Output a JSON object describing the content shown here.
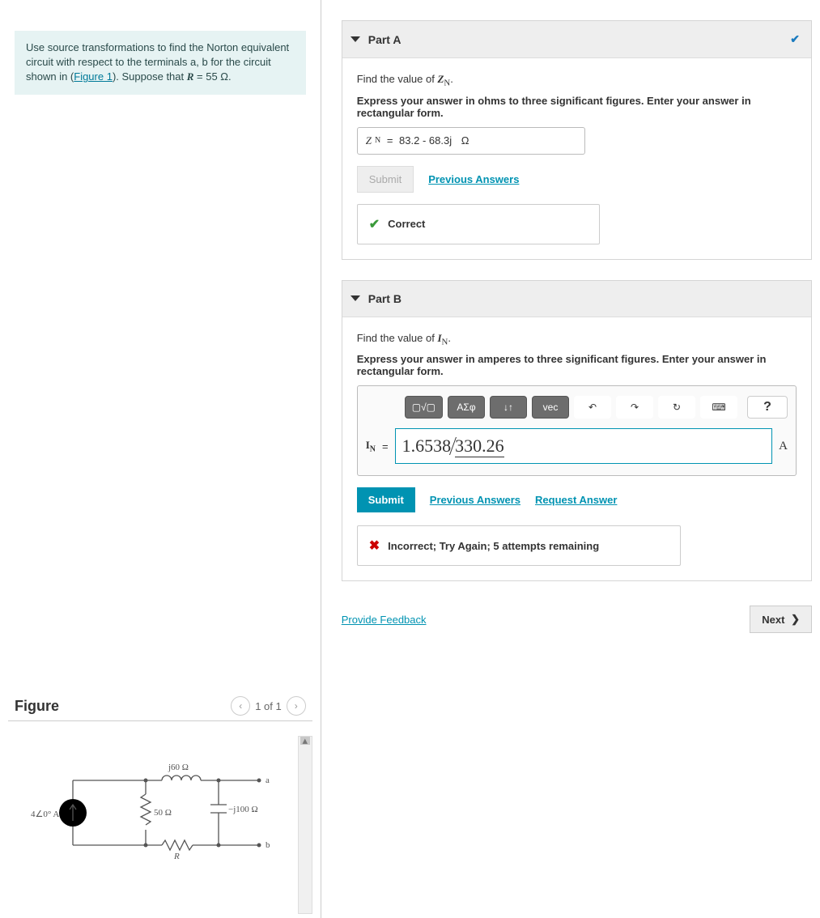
{
  "intro": {
    "text_before_link": "Use source transformations to find the Norton equivalent circuit with respect to the terminals a, b for the circuit shown in (",
    "link_text": "Figure 1",
    "text_after_link": "). Suppose that ",
    "var": "R",
    "equals": " = 55 Ω."
  },
  "figure": {
    "title": "Figure",
    "pager": "1 of 1",
    "labels": {
      "source": "4∠0° A",
      "r1": "50 Ω",
      "l": "j60 Ω",
      "c": "−j100 Ω",
      "r2": "R",
      "term_a": "a",
      "term_b": "b"
    }
  },
  "partA": {
    "title": "Part A",
    "prompt_prefix": "Find the value of ",
    "prompt_var": "Z",
    "prompt_sub": "N",
    "hint": "Express your answer in ohms to three significant figures. Enter your answer in rectangular form.",
    "ans_var": "Z",
    "ans_sub": "N",
    "ans_value": "83.2 - 68.3j",
    "ans_unit": "Ω",
    "submit": "Submit",
    "prev": "Previous Answers",
    "feedback": "Correct"
  },
  "partB": {
    "title": "Part B",
    "prompt_prefix": "Find the value of ",
    "prompt_var": "I",
    "prompt_sub": "N",
    "hint": "Express your answer in amperes to three significant figures. Enter your answer in rectangular form.",
    "toolbar": {
      "templates": "▢√▢",
      "greek": "ΑΣφ",
      "scripts": "↓↑",
      "vec": "vec",
      "undo": "↶",
      "redo": "↷",
      "reset": "↻",
      "keyboard": "⌨",
      "help": "?"
    },
    "eq_var": "I",
    "eq_sub": "N",
    "eq_mag": "1.6538",
    "eq_ang": "330.26",
    "eq_unit": "A",
    "submit": "Submit",
    "prev": "Previous Answers",
    "request": "Request Answer",
    "feedback": "Incorrect; Try Again; 5 attempts remaining"
  },
  "footer": {
    "feedback": "Provide Feedback",
    "next": "Next"
  }
}
